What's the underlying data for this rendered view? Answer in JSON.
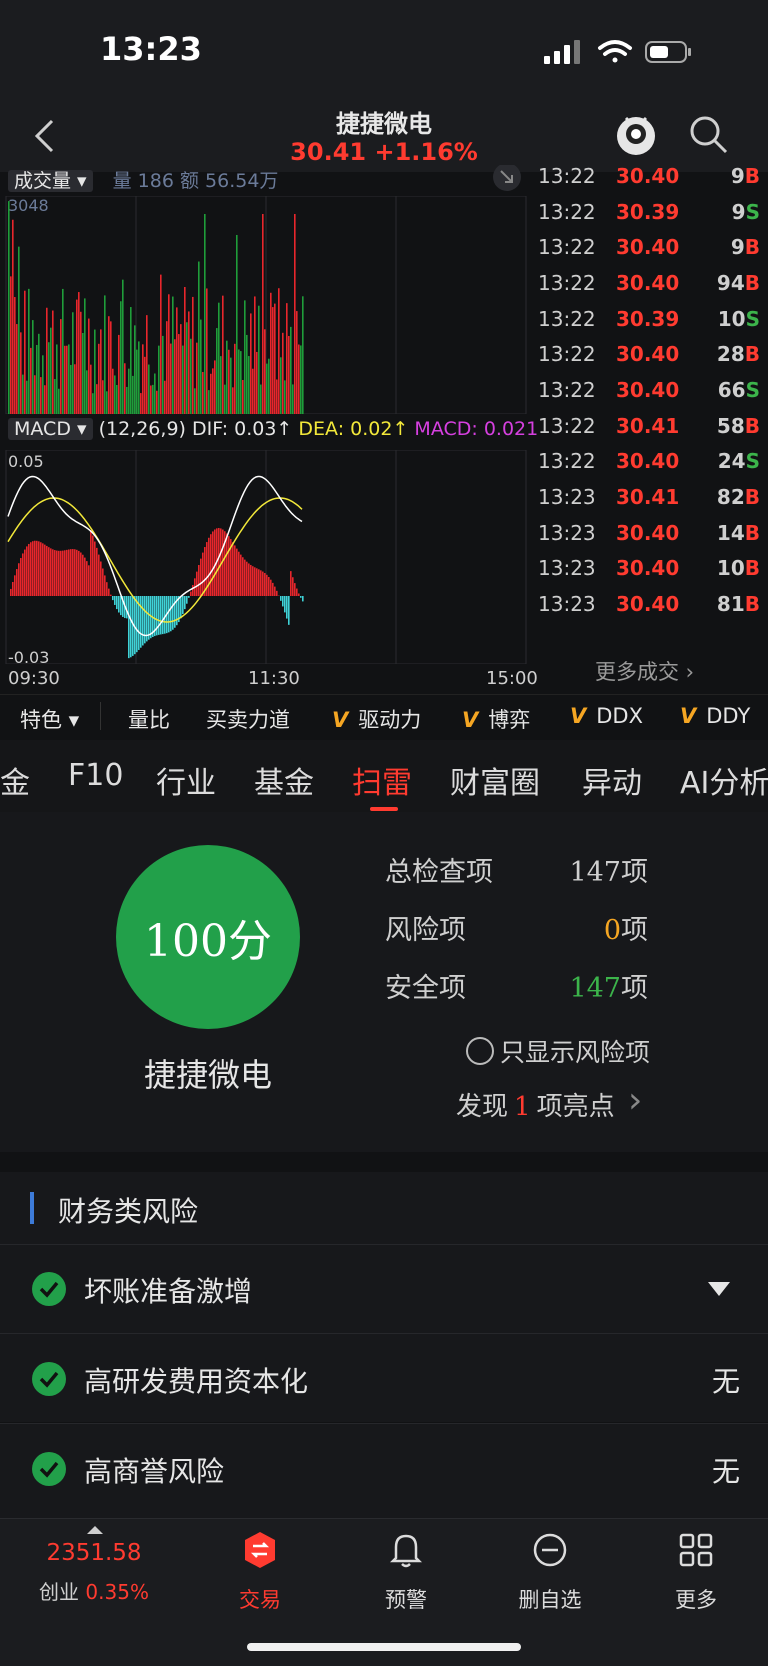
{
  "status": {
    "time": "13:23"
  },
  "header": {
    "title": "捷捷微电",
    "price": "30.41",
    "change": "+1.16%"
  },
  "chart": {
    "volume_tag": "成交量",
    "volume_info": "量 186  额 56.54万",
    "volume_max": "3048",
    "macd_tag": "MACD",
    "macd_params": "(12,26,9)",
    "dif": "DIF: 0.03↑",
    "dea": "DEA: 0.02↑",
    "macd": "MACD: 0.021",
    "macd_top": "0.05",
    "macd_bottom": "-0.03",
    "time_start": "09:30",
    "time_mid": "11:30",
    "time_end": "15:00",
    "colors": {
      "up": "#e8262c",
      "down": "#1f9d3a",
      "macd_neg": "#3fd3d8",
      "dif": "#ffffff",
      "dea": "#f2e83a"
    }
  },
  "trades": [
    {
      "time": "13:22",
      "price": "30.40",
      "vol": "9",
      "side": "B"
    },
    {
      "time": "13:22",
      "price": "30.39",
      "vol": "9",
      "side": "S"
    },
    {
      "time": "13:22",
      "price": "30.40",
      "vol": "9",
      "side": "B"
    },
    {
      "time": "13:22",
      "price": "30.40",
      "vol": "94",
      "side": "B"
    },
    {
      "time": "13:22",
      "price": "30.39",
      "vol": "10",
      "side": "S"
    },
    {
      "time": "13:22",
      "price": "30.40",
      "vol": "28",
      "side": "B"
    },
    {
      "time": "13:22",
      "price": "30.40",
      "vol": "66",
      "side": "S"
    },
    {
      "time": "13:22",
      "price": "30.41",
      "vol": "58",
      "side": "B"
    },
    {
      "time": "13:22",
      "price": "30.40",
      "vol": "24",
      "side": "S"
    },
    {
      "time": "13:23",
      "price": "30.41",
      "vol": "82",
      "side": "B"
    },
    {
      "time": "13:23",
      "price": "30.40",
      "vol": "14",
      "side": "B"
    },
    {
      "time": "13:23",
      "price": "30.40",
      "vol": "10",
      "side": "B"
    },
    {
      "time": "13:23",
      "price": "30.40",
      "vol": "81",
      "side": "B"
    }
  ],
  "more_trades": "更多成交",
  "indicators": {
    "special": "特色",
    "items": [
      "量比",
      "买卖力道"
    ],
    "v_items": [
      "驱动力",
      "博弈",
      "DDX",
      "DDY"
    ]
  },
  "tabs": [
    "金",
    "F10",
    "行业",
    "基金",
    "扫雷",
    "财富圈",
    "异动",
    "AI分析"
  ],
  "scan": {
    "score": "100分",
    "name": "捷捷微电",
    "total_label": "总检查项",
    "total_num": "147",
    "total_unit": "项",
    "risk_label": "风险项",
    "risk_num": "0",
    "risk_unit": "项",
    "safe_label": "安全项",
    "safe_num": "147",
    "safe_unit": "项",
    "only_risk": "只显示风险项",
    "highlight_pre": "发现",
    "highlight_num": "1",
    "highlight_post": "项亮点"
  },
  "risk": {
    "title": "财务类风险",
    "items": [
      {
        "label": "坏账准备激增",
        "right": ""
      },
      {
        "label": "高研发费用资本化",
        "right": "无"
      },
      {
        "label": "高商誉风险",
        "right": "无"
      }
    ]
  },
  "bottom": {
    "index_value": "2351.58",
    "index_name": "创业",
    "index_change": "0.35%",
    "nav": [
      "交易",
      "预警",
      "删自选",
      "更多"
    ]
  }
}
